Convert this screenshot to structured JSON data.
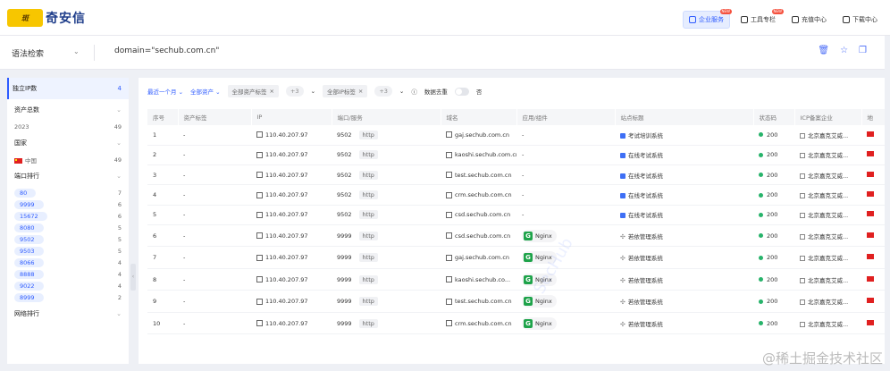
{
  "brand": {
    "mark": "斑",
    "name": "奇安信"
  },
  "top_links": [
    {
      "label": "企业服务",
      "active": true,
      "new": "NEW"
    },
    {
      "label": "工具专栏",
      "active": false,
      "new": "NEW"
    },
    {
      "label": "充值中心",
      "active": false,
      "new": ""
    },
    {
      "label": "下载中心",
      "active": false,
      "new": ""
    }
  ],
  "search": {
    "type": "语法检索",
    "query": "domain=\"sechub.com.cn\""
  },
  "sidebar": {
    "unique_ip": {
      "label": "独立IP数",
      "count": "4"
    },
    "total_assets": {
      "label": "资产总数",
      "year": "2023",
      "count": "49"
    },
    "country": {
      "label": "国家",
      "name": "中国",
      "count": "49"
    },
    "ports": {
      "label": "端口排行",
      "items": [
        {
          "port": "80",
          "count": "7"
        },
        {
          "port": "9999",
          "count": "6"
        },
        {
          "port": "15672",
          "count": "6"
        },
        {
          "port": "8080",
          "count": "5"
        },
        {
          "port": "9502",
          "count": "5"
        },
        {
          "port": "9503",
          "count": "5"
        },
        {
          "port": "8066",
          "count": "4"
        },
        {
          "port": "8888",
          "count": "4"
        },
        {
          "port": "9022",
          "count": "4"
        },
        {
          "port": "8999",
          "count": "2"
        }
      ]
    },
    "more": "网络排行"
  },
  "filters": {
    "time": "最近一个月",
    "assets": "全部资产",
    "tag1": "全部资产标签",
    "tag1_count": "+3",
    "tag2": "全部IP标签",
    "tag2_count": "+3",
    "dedupe": "数据去重",
    "dedupe_state": "否"
  },
  "table": {
    "headers": [
      "序号",
      "资产标签",
      "IP",
      "端口/服务",
      "域名",
      "应用/组件",
      "站点标题",
      "状态码",
      "ICP备案企业",
      "地"
    ],
    "rows": [
      {
        "no": "1",
        "tag": "-",
        "ip": "110.40.207.97",
        "port": "9502",
        "proto": "http",
        "domain": "gaj.sechub.com.cn",
        "app": "-",
        "title": "考试培训系统",
        "status": "200",
        "icp": "北京嘉克艾威..."
      },
      {
        "no": "2",
        "tag": "-",
        "ip": "110.40.207.97",
        "port": "9502",
        "proto": "http",
        "domain": "kaoshi.sechub.com.cn",
        "app": "-",
        "title": "在线考试系统",
        "status": "200",
        "icp": "北京嘉克艾威..."
      },
      {
        "no": "3",
        "tag": "-",
        "ip": "110.40.207.97",
        "port": "9502",
        "proto": "http",
        "domain": "test.sechub.com.cn",
        "app": "-",
        "title": "在线考试系统",
        "status": "200",
        "icp": "北京嘉克艾威..."
      },
      {
        "no": "4",
        "tag": "-",
        "ip": "110.40.207.97",
        "port": "9502",
        "proto": "http",
        "domain": "crm.sechub.com.cn",
        "app": "-",
        "title": "在线考试系统",
        "status": "200",
        "icp": "北京嘉克艾威..."
      },
      {
        "no": "5",
        "tag": "-",
        "ip": "110.40.207.97",
        "port": "9502",
        "proto": "http",
        "domain": "csd.sechub.com.cn",
        "app": "-",
        "title": "在线考试系统",
        "status": "200",
        "icp": "北京嘉克艾威..."
      },
      {
        "no": "6",
        "tag": "-",
        "ip": "110.40.207.97",
        "port": "9999",
        "proto": "http",
        "domain": "csd.sechub.com.cn",
        "app": "Nginx",
        "title": "若依管理系统",
        "status": "200",
        "icp": "北京嘉克艾威..."
      },
      {
        "no": "7",
        "tag": "-",
        "ip": "110.40.207.97",
        "port": "9999",
        "proto": "http",
        "domain": "gaj.sechub.com.cn",
        "app": "Nginx",
        "title": "若依管理系统",
        "status": "200",
        "icp": "北京嘉克艾威..."
      },
      {
        "no": "8",
        "tag": "-",
        "ip": "110.40.207.97",
        "port": "9999",
        "proto": "http",
        "domain": "kaoshi.sechub.co...",
        "app": "Nginx",
        "title": "若依管理系统",
        "status": "200",
        "icp": "北京嘉克艾威..."
      },
      {
        "no": "9",
        "tag": "-",
        "ip": "110.40.207.97",
        "port": "9999",
        "proto": "http",
        "domain": "test.sechub.com.cn",
        "app": "Nginx",
        "title": "若依管理系统",
        "status": "200",
        "icp": "北京嘉克艾威..."
      },
      {
        "no": "10",
        "tag": "-",
        "ip": "110.40.207.97",
        "port": "9999",
        "proto": "http",
        "domain": "crm.sechub.com.cn",
        "app": "Nginx",
        "title": "若依管理系统",
        "status": "200",
        "icp": "北京嘉克艾威..."
      }
    ]
  },
  "watermark": "SecHub",
  "footer_watermark": "@稀土掘金技术社区",
  "colors": {
    "accent": "#2e5bff",
    "ok": "#27b36a",
    "nginx": "#1ea34a"
  }
}
